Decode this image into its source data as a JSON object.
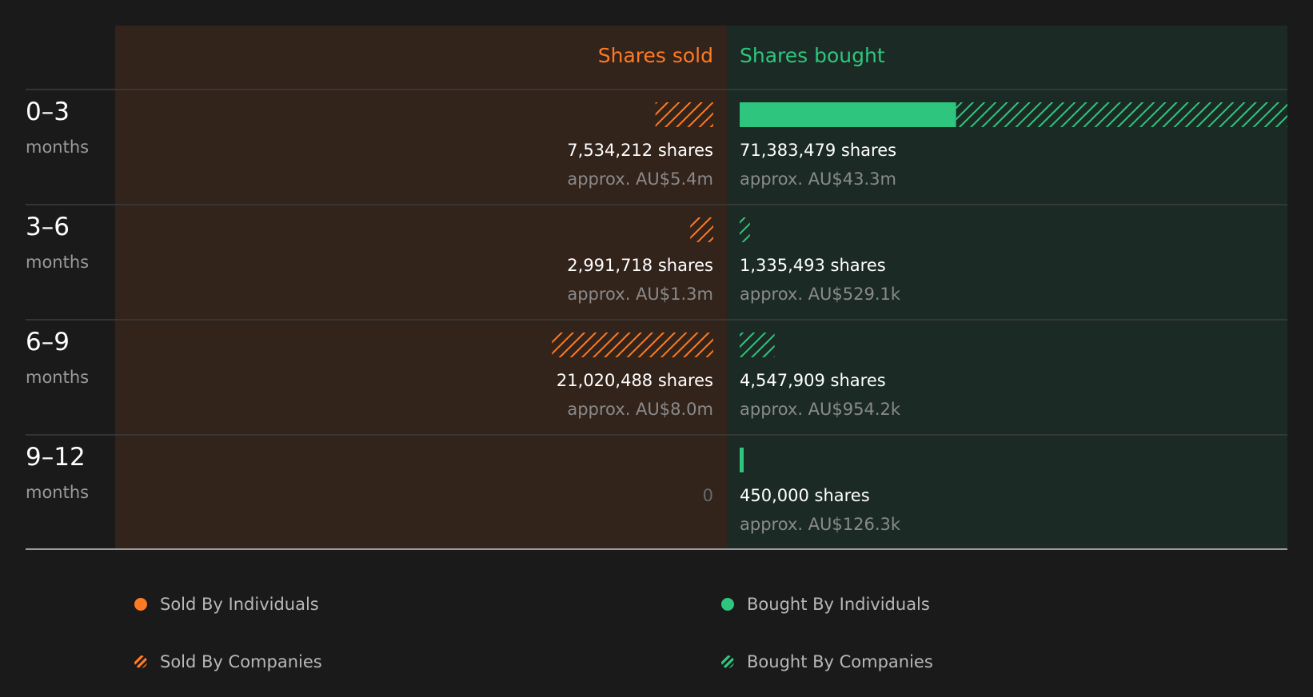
{
  "chart_data": {
    "type": "bar",
    "layout": "diverging",
    "columns": {
      "sold": {
        "label": "Shares sold",
        "color": "#ff7a22"
      },
      "bought": {
        "label": "Shares bought",
        "color": "#2ec67e"
      }
    },
    "series": [
      {
        "name": "Sold By Individuals",
        "side": "sold",
        "holder": "individuals",
        "values": [
          0,
          0,
          0,
          0
        ]
      },
      {
        "name": "Sold By Companies",
        "side": "sold",
        "holder": "companies",
        "values": [
          7534212,
          2991718,
          21020488,
          0
        ]
      },
      {
        "name": "Bought By Individuals",
        "side": "bought",
        "holder": "individuals",
        "values": [
          28200000,
          0,
          0,
          450000
        ]
      },
      {
        "name": "Bought By Companies",
        "side": "bought",
        "holder": "companies",
        "values": [
          43183479,
          1335493,
          4547909,
          0
        ]
      }
    ],
    "rows": [
      {
        "range": "0–3",
        "unit": "months",
        "sold": {
          "shares": "7,534,212 shares",
          "approx": "approx. AU$5.4m",
          "empty": ""
        },
        "bought": {
          "shares": "71,383,479 shares",
          "approx": "approx. AU$43.3m"
        }
      },
      {
        "range": "3–6",
        "unit": "months",
        "sold": {
          "shares": "2,991,718 shares",
          "approx": "approx. AU$1.3m",
          "empty": ""
        },
        "bought": {
          "shares": "1,335,493 shares",
          "approx": "approx. AU$529.1k"
        }
      },
      {
        "range": "6–9",
        "unit": "months",
        "sold": {
          "shares": "21,020,488 shares",
          "approx": "approx. AU$8.0m",
          "empty": ""
        },
        "bought": {
          "shares": "4,547,909 shares",
          "approx": "approx. AU$954.2k"
        }
      },
      {
        "range": "9–12",
        "unit": "months",
        "sold": {
          "shares": "",
          "approx": "",
          "empty": "0"
        },
        "bought": {
          "shares": "450,000 shares",
          "approx": "approx. AU$126.3k"
        }
      }
    ],
    "legend": [
      {
        "label": "Sold By Individuals",
        "color": "#ff7a22",
        "pattern": "solid"
      },
      {
        "label": "Bought By Individuals",
        "color": "#2ec67e",
        "pattern": "solid"
      },
      {
        "label": "Sold By Companies",
        "color": "#ff7a22",
        "pattern": "hatched"
      },
      {
        "label": "Bought By Companies",
        "color": "#2ec67e",
        "pattern": "hatched"
      }
    ],
    "legend_position": "bottom",
    "colors": {
      "background": "#1a1a1a",
      "sold_panel": "#32231b",
      "bought_panel": "#1b2a24",
      "divider": "#3c3c3c",
      "text": "#ffffff",
      "muted": "#8a8a8a"
    }
  }
}
